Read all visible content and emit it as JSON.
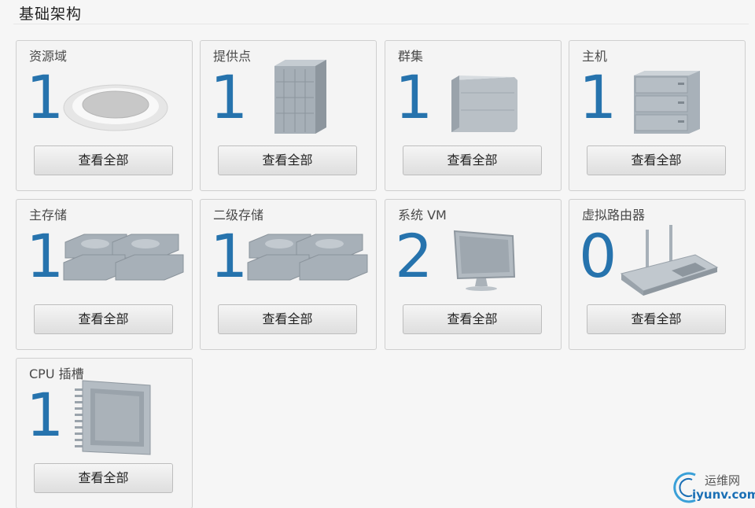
{
  "page": {
    "title": "基础架构"
  },
  "cards": [
    {
      "title": "资源域",
      "count": "1",
      "button": "查看全部",
      "icon": "zone-icon"
    },
    {
      "title": "提供点",
      "count": "1",
      "button": "查看全部",
      "icon": "pod-icon"
    },
    {
      "title": "群集",
      "count": "1",
      "button": "查看全部",
      "icon": "cluster-icon"
    },
    {
      "title": "主机",
      "count": "1",
      "button": "查看全部",
      "icon": "host-icon"
    },
    {
      "title": "主存储",
      "count": "1",
      "button": "查看全部",
      "icon": "primary-storage-icon"
    },
    {
      "title": "二级存储",
      "count": "1",
      "button": "查看全部",
      "icon": "secondary-storage-icon"
    },
    {
      "title": "系统 VM",
      "count": "2",
      "button": "查看全部",
      "icon": "monitor-icon"
    },
    {
      "title": "虚拟路由器",
      "count": "0",
      "button": "查看全部",
      "icon": "router-icon"
    },
    {
      "title": "CPU 插槽",
      "count": "1",
      "button": "查看全部",
      "icon": "cpu-socket-icon"
    }
  ],
  "watermark": {
    "line1": "运维网",
    "line2": "iyunv.com"
  }
}
